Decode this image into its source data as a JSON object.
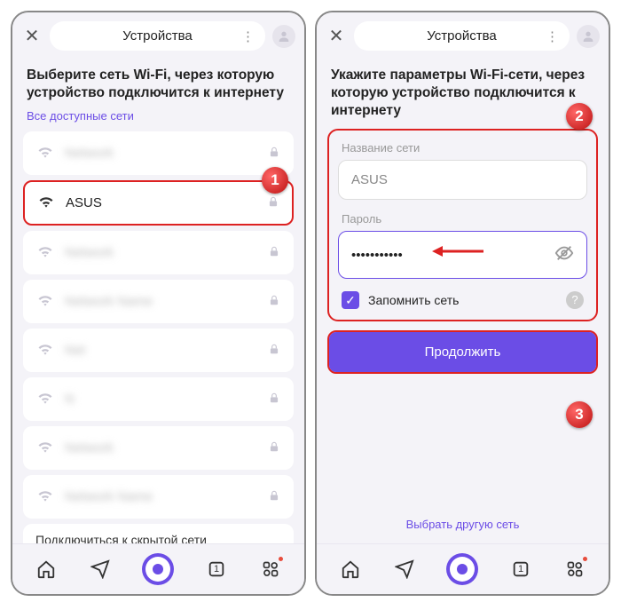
{
  "header": {
    "title": "Устройства"
  },
  "left": {
    "heading": "Выберите сеть Wi-Fi, через которую устройство подключится к интернету",
    "subhead": "Все доступные сети",
    "networks": [
      {
        "name": "Network",
        "blur": true,
        "strong": false
      },
      {
        "name": "ASUS",
        "blur": false,
        "strong": true
      },
      {
        "name": "Network",
        "blur": true,
        "strong": false
      },
      {
        "name": "Network Name",
        "blur": true,
        "strong": false
      },
      {
        "name": "Net",
        "blur": true,
        "strong": false
      },
      {
        "name": "N",
        "blur": true,
        "strong": false
      },
      {
        "name": "Network",
        "blur": true,
        "strong": false
      },
      {
        "name": "Network Name",
        "blur": true,
        "strong": false
      }
    ],
    "hidden_link": "Подключиться к скрытой сети"
  },
  "right": {
    "heading": "Укажите параметры Wi-Fi-сети, через которую устройство подключится к интернету",
    "name_label": "Название сети",
    "name_value": "ASUS",
    "pass_label": "Пароль",
    "pass_value": "•••••••••••",
    "remember": "Запомнить сеть",
    "continue": "Продолжить",
    "other": "Выбрать другую сеть"
  },
  "nav": {
    "tab_count": "1"
  },
  "badges": {
    "b1": "1",
    "b2": "2",
    "b3": "3"
  }
}
